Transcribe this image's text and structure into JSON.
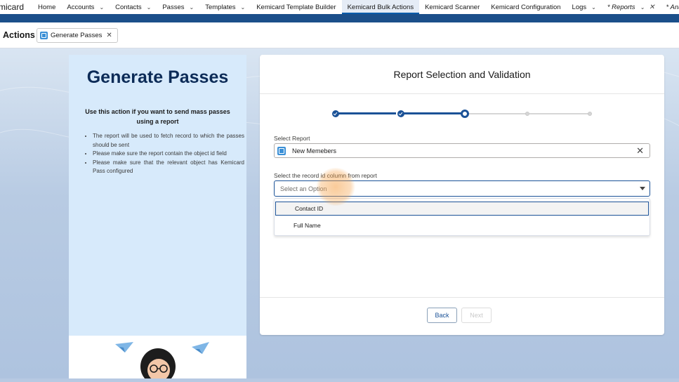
{
  "nav": {
    "app_name": "micard",
    "items": [
      {
        "label": "Home",
        "chevron": false
      },
      {
        "label": "Accounts",
        "chevron": true
      },
      {
        "label": "Contacts",
        "chevron": true
      },
      {
        "label": "Passes",
        "chevron": true
      },
      {
        "label": "Templates",
        "chevron": true
      },
      {
        "label": "Kemicard Template Builder",
        "chevron": false
      },
      {
        "label": "Kemicard Bulk Actions",
        "chevron": false,
        "active": true
      },
      {
        "label": "Kemicard Scanner",
        "chevron": false
      },
      {
        "label": "Kemicard Configuration",
        "chevron": false
      },
      {
        "label": "Logs",
        "chevron": true
      },
      {
        "label": "* Reports",
        "chevron": true,
        "closable": true
      },
      {
        "label": "* Ana",
        "chevron": false
      }
    ],
    "chevron_glyph": "chevron-down-icon",
    "close_glyph": "close-icon"
  },
  "tabbar": {
    "section_title": "Actions",
    "tab_label": "Generate Passes"
  },
  "left_panel": {
    "title": "Generate Passes",
    "subtitle": "Use this action if you want to send mass passes using a report",
    "bullets": [
      "The report will be used to fetch record to which the passes should be sent",
      "Please make sure the report contain the object id field",
      "Please make sure that the relevant object has Kemicard Pass configured"
    ]
  },
  "wizard": {
    "title": "Report Selection and Validation",
    "steps_total": 5,
    "current_step": 3,
    "select_report_label": "Select Report",
    "selected_report": "New Memebers",
    "record_id_label": "Select the record id column from report",
    "record_id_placeholder": "Select an Option",
    "options": [
      "Contact ID",
      "Full Name"
    ],
    "focused_option": "Contact ID",
    "back_label": "Back",
    "next_label": "Next"
  },
  "colors": {
    "brand_bar": "#1b4f8a",
    "accent": "#1b5297",
    "panel_bg": "#d7eafb",
    "title_color": "#0c2b57"
  }
}
